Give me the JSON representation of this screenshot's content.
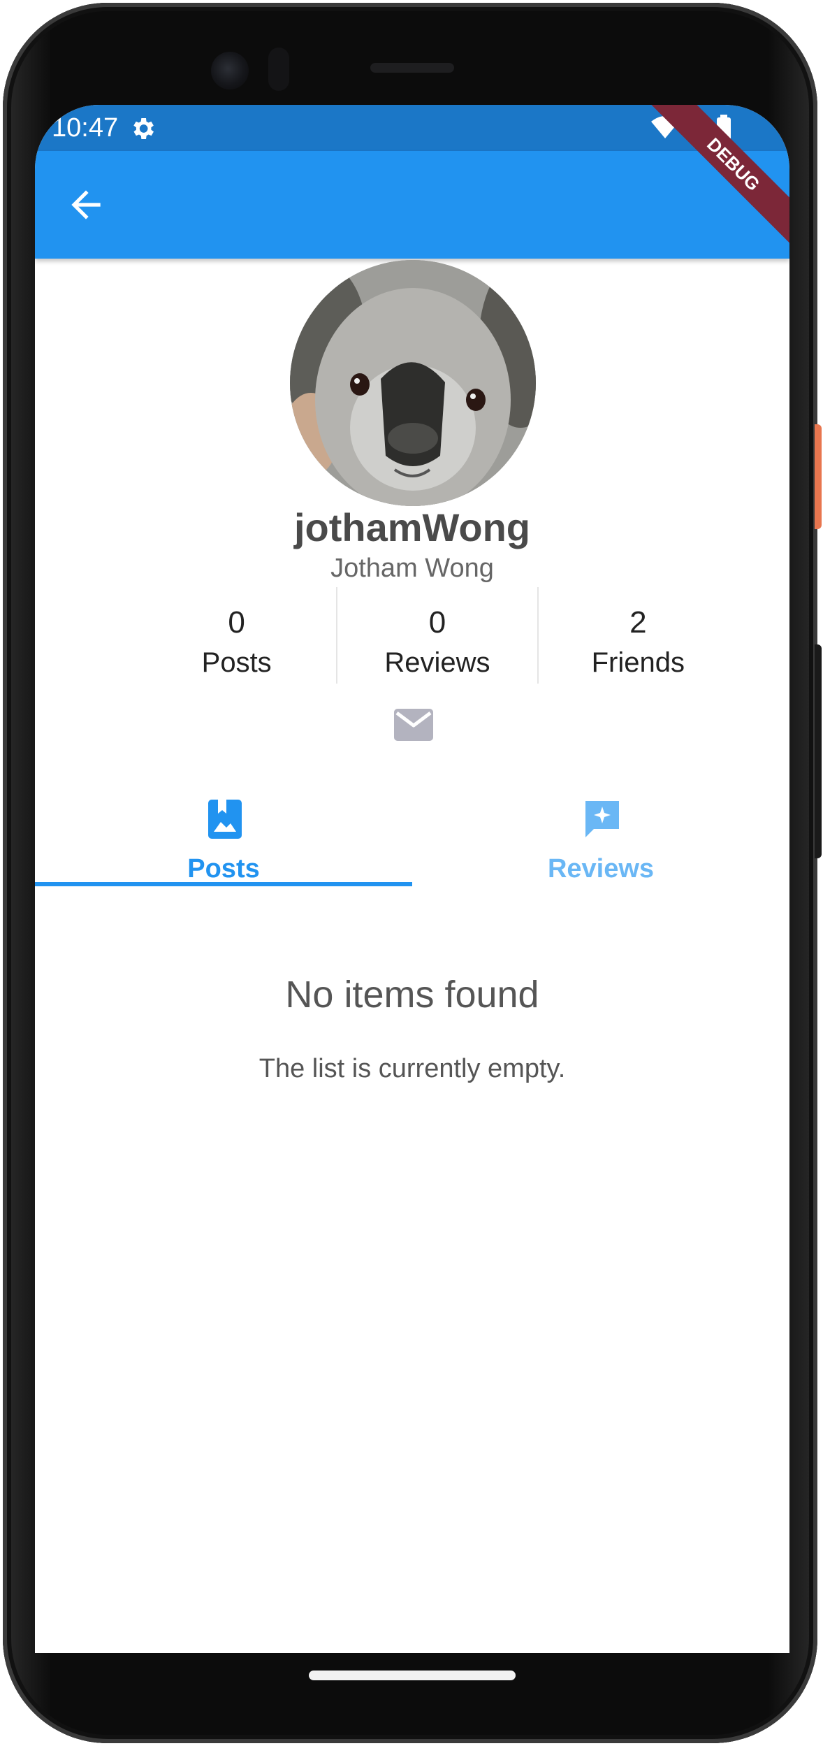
{
  "status_bar": {
    "time": "10:47",
    "icons": [
      "gear-icon",
      "wifi-icon",
      "signal-icon",
      "battery-icon"
    ]
  },
  "app_bar": {
    "back_icon": "arrow-left-icon",
    "debug_banner": "DEBUG",
    "color": "#2193f0"
  },
  "profile": {
    "username": "jothamWong",
    "full_name": "Jotham Wong",
    "avatar": "koala-photo"
  },
  "stats": [
    {
      "value": "0",
      "label": "Posts"
    },
    {
      "value": "0",
      "label": "Reviews"
    },
    {
      "value": "2",
      "label": "Friends"
    }
  ],
  "actions": {
    "mail_icon": "mail-icon"
  },
  "tabs": [
    {
      "label": "Posts",
      "icon": "photo-bookmark-icon",
      "selected": true,
      "color": "#2193f0"
    },
    {
      "label": "Reviews",
      "icon": "star-chat-icon",
      "selected": false,
      "color": "#6ab7f5"
    }
  ],
  "empty_state": {
    "title": "No items found",
    "subtitle": "The list is currently empty."
  }
}
